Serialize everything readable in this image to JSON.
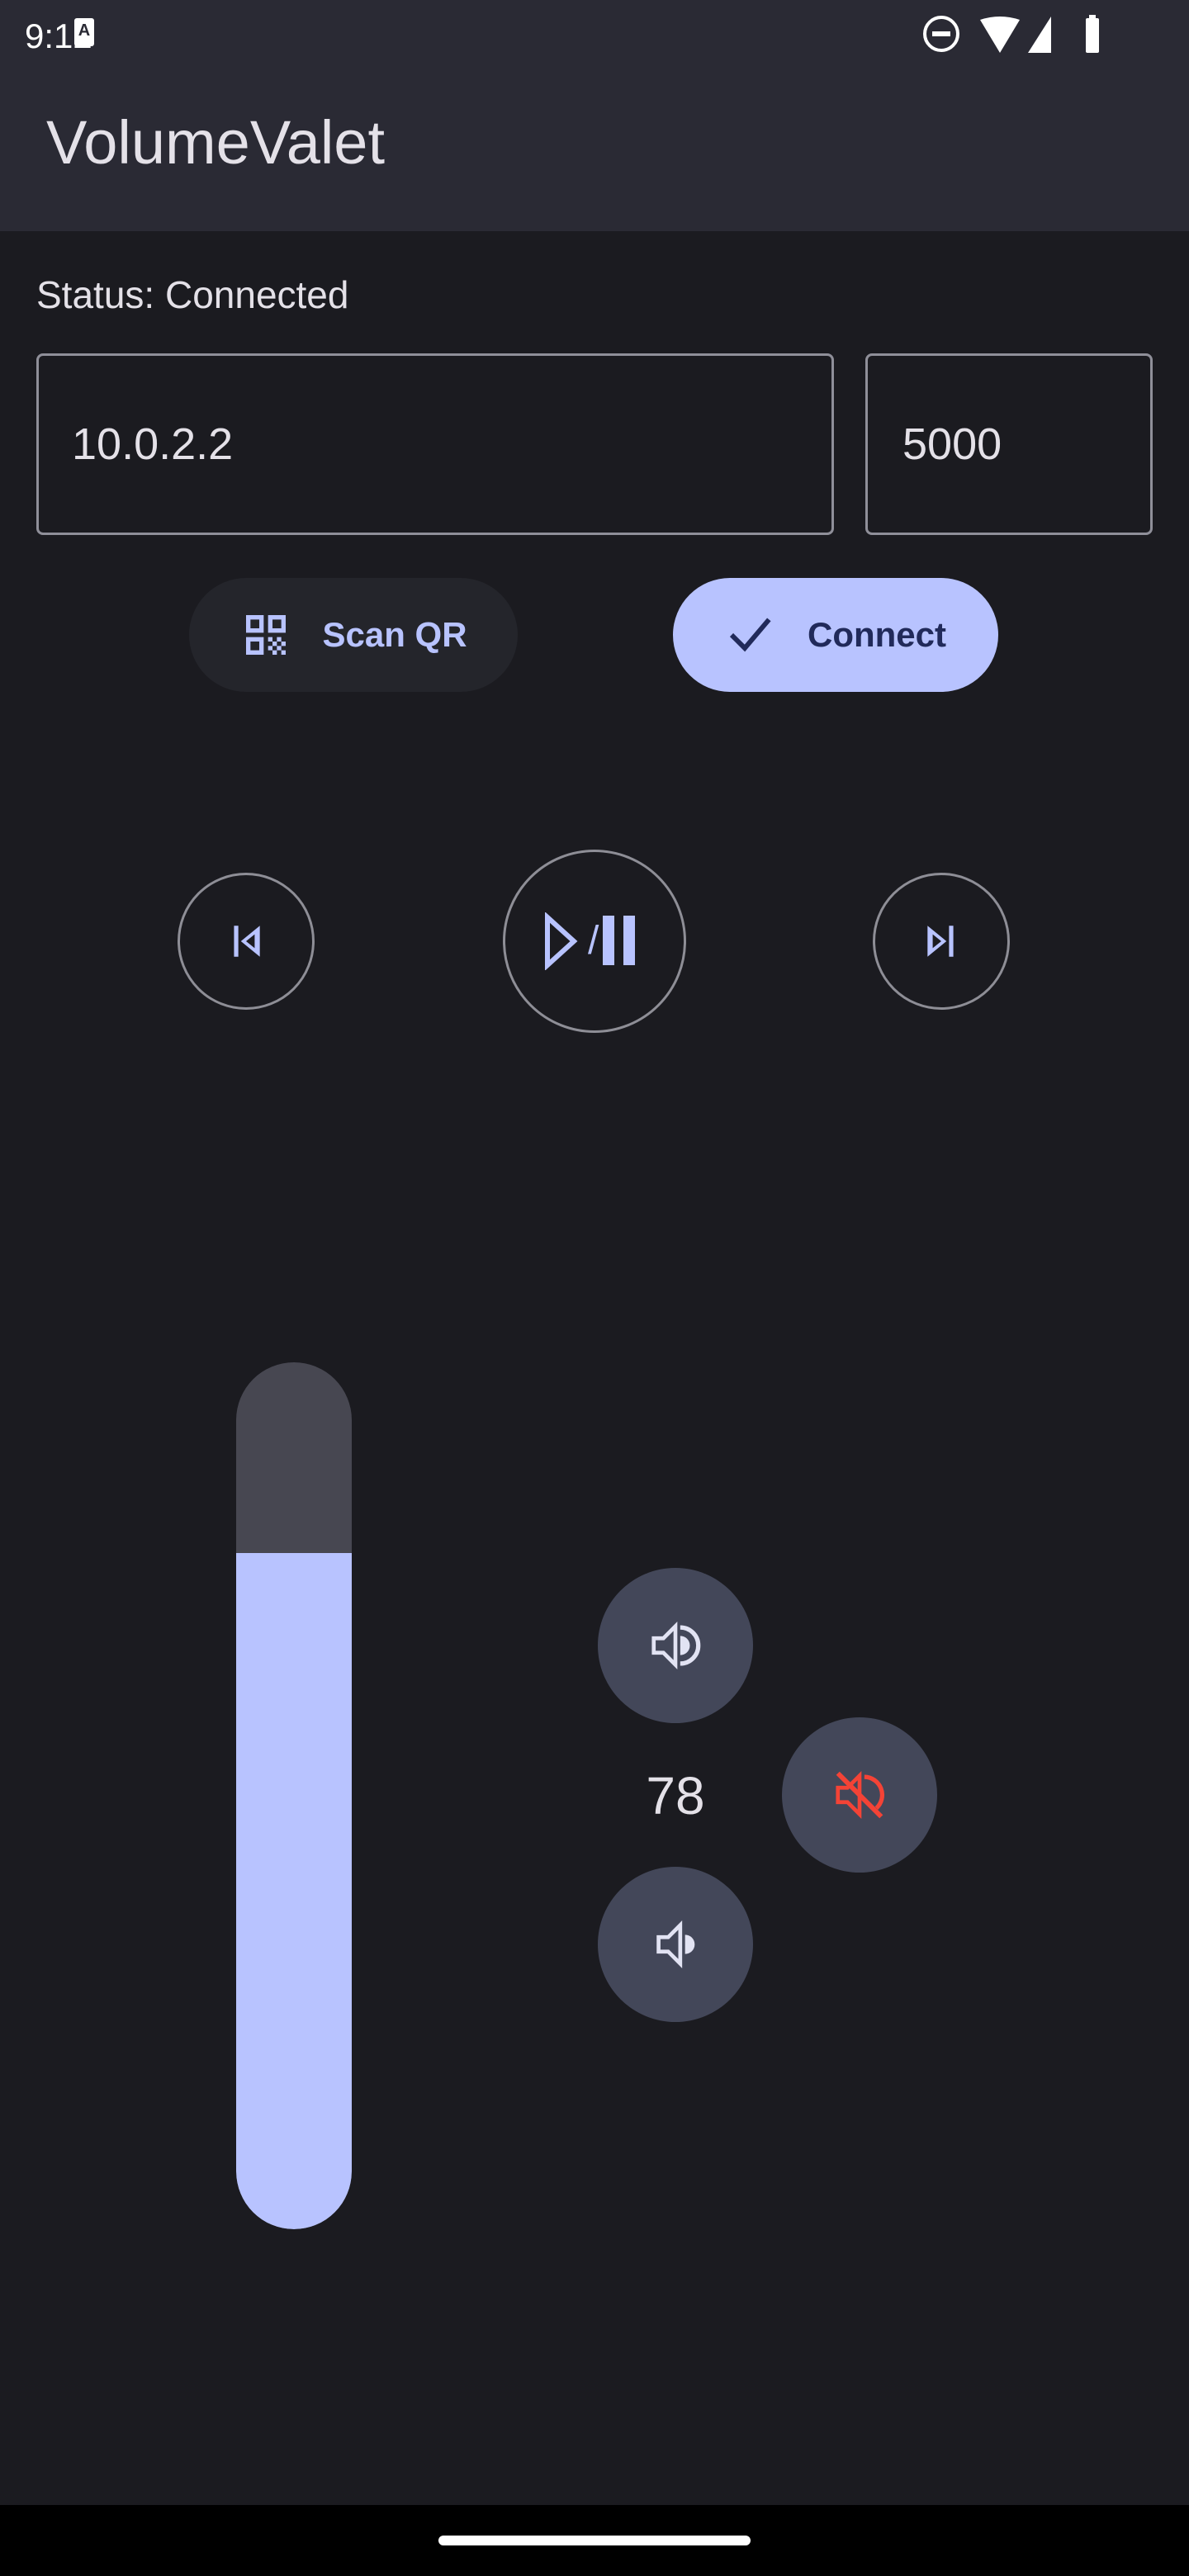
{
  "status_bar": {
    "time": "9:12",
    "icons": [
      "a11y-icon",
      "dnd-icon",
      "wifi-icon",
      "signal-icon",
      "battery-icon"
    ]
  },
  "app_bar": {
    "title": "VolumeValet"
  },
  "connection": {
    "status": "Status: Connected",
    "ip": "10.0.2.2",
    "port": "5000",
    "scan_label": "Scan QR",
    "connect_label": "Connect"
  },
  "media": {
    "prev": "skip-previous-icon",
    "play_pause": "play-pause-icon",
    "slash": "/",
    "next": "skip-next-icon"
  },
  "volume": {
    "value": "78",
    "level_percent": 78,
    "up": "volume-up-icon",
    "down": "volume-down-icon",
    "mute": "volume-off-icon"
  },
  "colors": {
    "accent": "#b8c3ff",
    "mute": "#f44336",
    "background": "#1b1b20",
    "app_bar": "#2a2a34"
  }
}
